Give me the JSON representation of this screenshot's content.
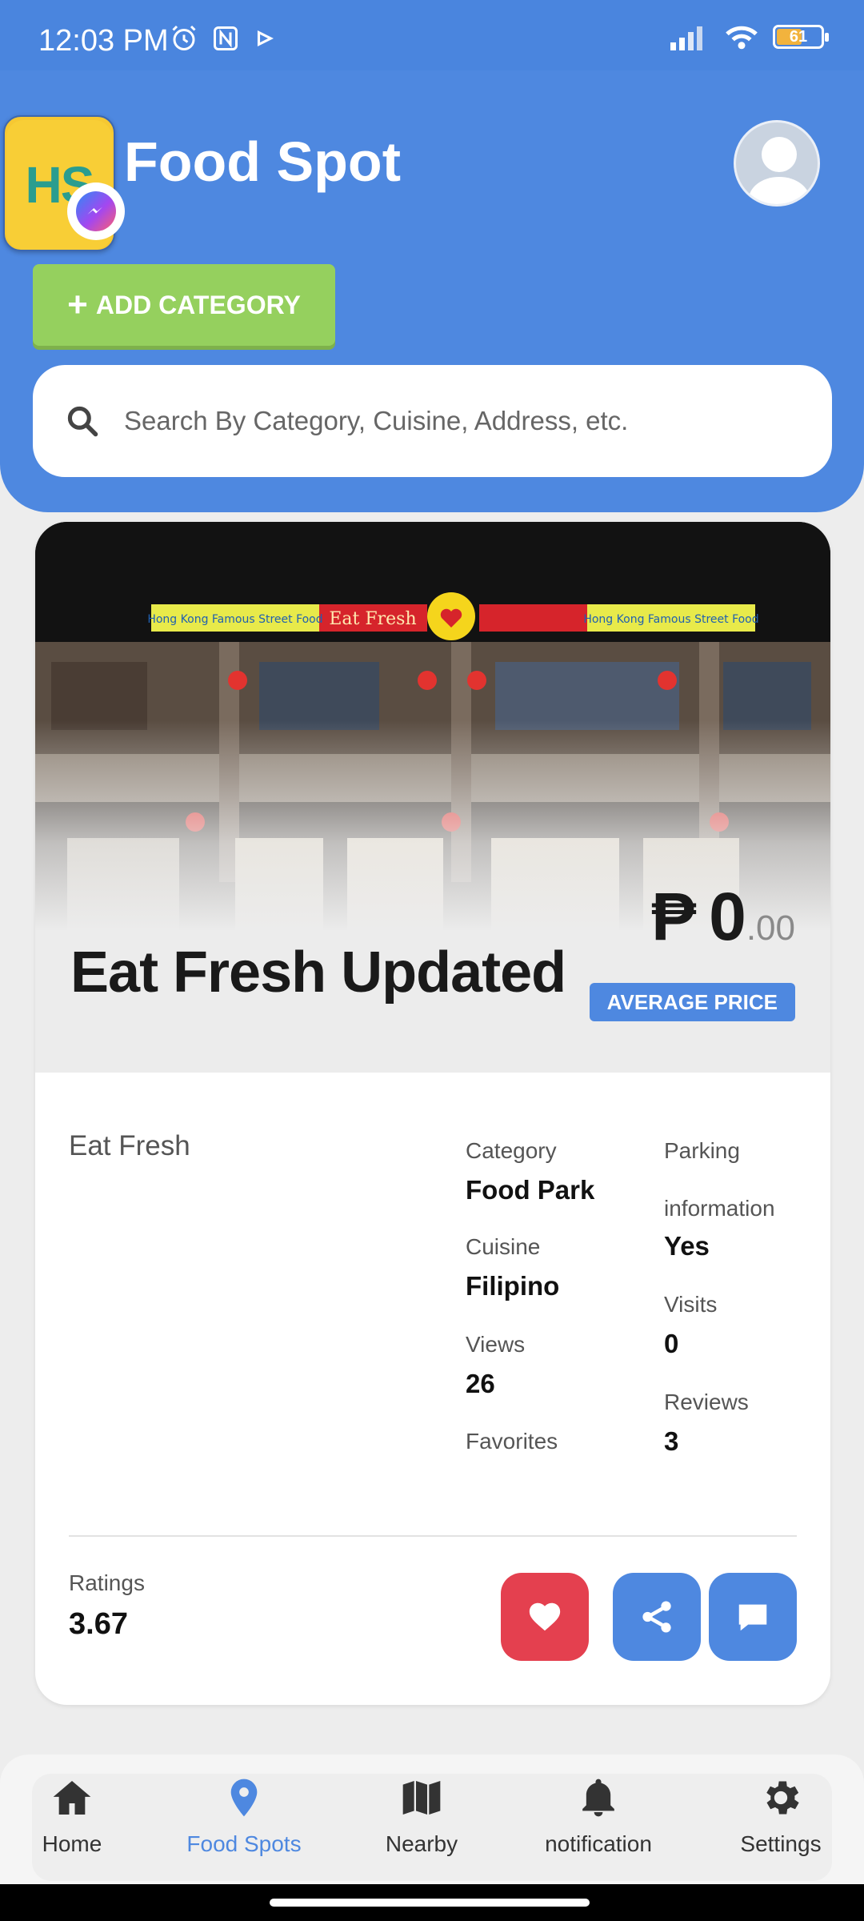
{
  "status_bar": {
    "time": "12:03 PM",
    "battery": "61",
    "battery_level": 0.61
  },
  "header": {
    "app_title": "Food Spot",
    "logo_letters": "HS",
    "add_category_label": "ADD CATEGORY",
    "search_placeholder": "Search By Category, Cuisine, Address, etc."
  },
  "card": {
    "title": "Eat Fresh Updated",
    "price_currency": "₱",
    "price_whole": "0",
    "price_cents": ".00",
    "average_price_label": "AVERAGE PRICE",
    "store_name": "Eat Fresh",
    "category_label": "Category",
    "category_value": "Food Park",
    "cuisine_label": "Cuisine",
    "cuisine_value": "Filipino",
    "views_label": "Views",
    "views_value": "26",
    "favorites_label": "Favorites",
    "parking_label_line1": "Parking",
    "parking_label_line2": "information",
    "parking_value": "Yes",
    "visits_label": "Visits",
    "visits_value": "0",
    "reviews_label": "Reviews",
    "reviews_value": "3",
    "ratings_label": "Ratings",
    "ratings_value": "3.67",
    "hero_sign_left": "Hong Kong Famous Street Food",
    "hero_sign_center": "Eat Fresh",
    "hero_sign_right": "Hong Kong Famous Street Food"
  },
  "nav": {
    "items": [
      {
        "label": "Home",
        "icon": "home-icon"
      },
      {
        "label": "Food Spots",
        "icon": "map-pin-icon"
      },
      {
        "label": "Nearby",
        "icon": "map-icon"
      },
      {
        "label": "notification",
        "icon": "bell-icon"
      },
      {
        "label": "Settings",
        "icon": "gear-icon"
      }
    ],
    "active_index": 1
  },
  "colors": {
    "primary": "#4e88e0",
    "add_button": "#95d05e",
    "favorite_button": "#e4404f"
  }
}
